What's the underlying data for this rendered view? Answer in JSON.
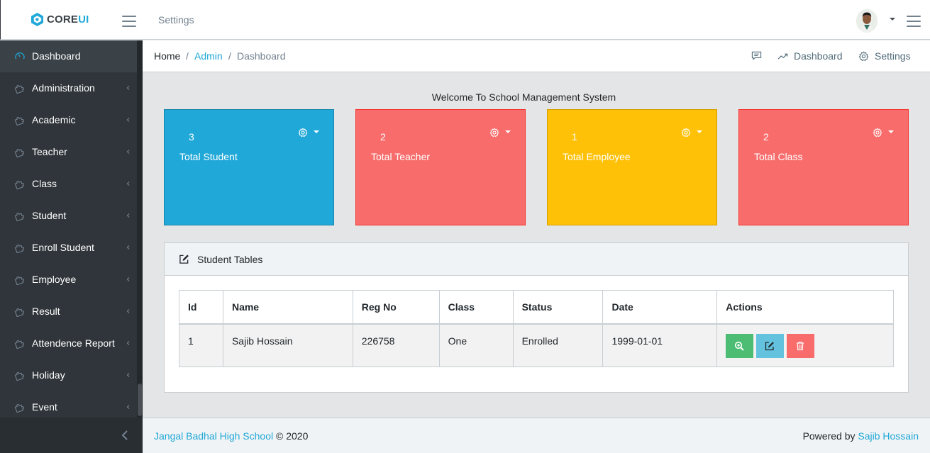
{
  "header": {
    "brand_core": "CORE",
    "brand_ui": "UI",
    "nav_settings": "Settings"
  },
  "sidebar": {
    "items": [
      {
        "label": "Dashboard",
        "icon": "speedometer-icon",
        "active": true
      },
      {
        "label": "Administration",
        "icon": "puzzle-icon"
      },
      {
        "label": "Academic",
        "icon": "puzzle-icon"
      },
      {
        "label": "Teacher",
        "icon": "puzzle-icon"
      },
      {
        "label": "Class",
        "icon": "puzzle-icon"
      },
      {
        "label": "Student",
        "icon": "puzzle-icon"
      },
      {
        "label": "Enroll Student",
        "icon": "puzzle-icon"
      },
      {
        "label": "Employee",
        "icon": "puzzle-icon"
      },
      {
        "label": "Result",
        "icon": "puzzle-icon"
      },
      {
        "label": "Attendence Report",
        "icon": "puzzle-icon"
      },
      {
        "label": "Holiday",
        "icon": "puzzle-icon"
      },
      {
        "label": "Event",
        "icon": "puzzle-icon"
      }
    ]
  },
  "breadcrumb": {
    "home": "Home",
    "admin": "Admin",
    "current": "Dashboard",
    "sep": "/",
    "menu": {
      "dashboard": "Dashboard",
      "settings": "Settings"
    }
  },
  "main": {
    "welcome": "Welcome To School Management System",
    "cards": [
      {
        "value": "3",
        "label": "Total Student",
        "color": "#20a8d8"
      },
      {
        "value": "2",
        "label": "Total Teacher",
        "color": "#f86c6b"
      },
      {
        "value": "1",
        "label": "Total Employee",
        "color": "#ffc107"
      },
      {
        "value": "2",
        "label": "Total Class",
        "color": "#f86c6b"
      }
    ],
    "table": {
      "title": "Student Tables",
      "columns": [
        "Id",
        "Name",
        "Reg No",
        "Class",
        "Status",
        "Date",
        "Actions"
      ],
      "rows": [
        {
          "id": "1",
          "name": "Sajib Hossain",
          "reg_no": "226758",
          "class": "One",
          "status": "Enrolled",
          "date": "1999-01-01"
        }
      ],
      "action_colors": {
        "view": "#4dbd74",
        "edit": "#63c2de",
        "delete": "#f86c6b"
      }
    }
  },
  "footer": {
    "school": "Jangal Badhal High School",
    "copyright": "© 2020",
    "powered_by": "Powered by",
    "author": "Sajib Hossain"
  }
}
